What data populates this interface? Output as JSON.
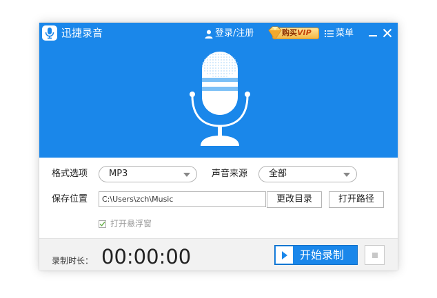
{
  "app": {
    "title": "迅捷录音"
  },
  "titlebar": {
    "login_label": "登录/注册",
    "vip_label": "购买",
    "vip_suffix": "VIP",
    "menu_label": "菜单"
  },
  "settings": {
    "format_label": "格式选项",
    "format_value": "MP3",
    "source_label": "声音来源",
    "source_value": "全部",
    "save_label": "保存位置",
    "save_path": "C:\\Users\\zch\\Music",
    "change_dir_label": "更改目录",
    "open_path_label": "打开路径",
    "float_window_label": "打开悬浮窗",
    "float_window_checked": true
  },
  "footer": {
    "duration_label": "录制时长：",
    "duration_value": "00:00:00",
    "start_label": "开始录制"
  },
  "colors": {
    "primary": "#1a87ea",
    "vip_gold": "#f2b845"
  }
}
